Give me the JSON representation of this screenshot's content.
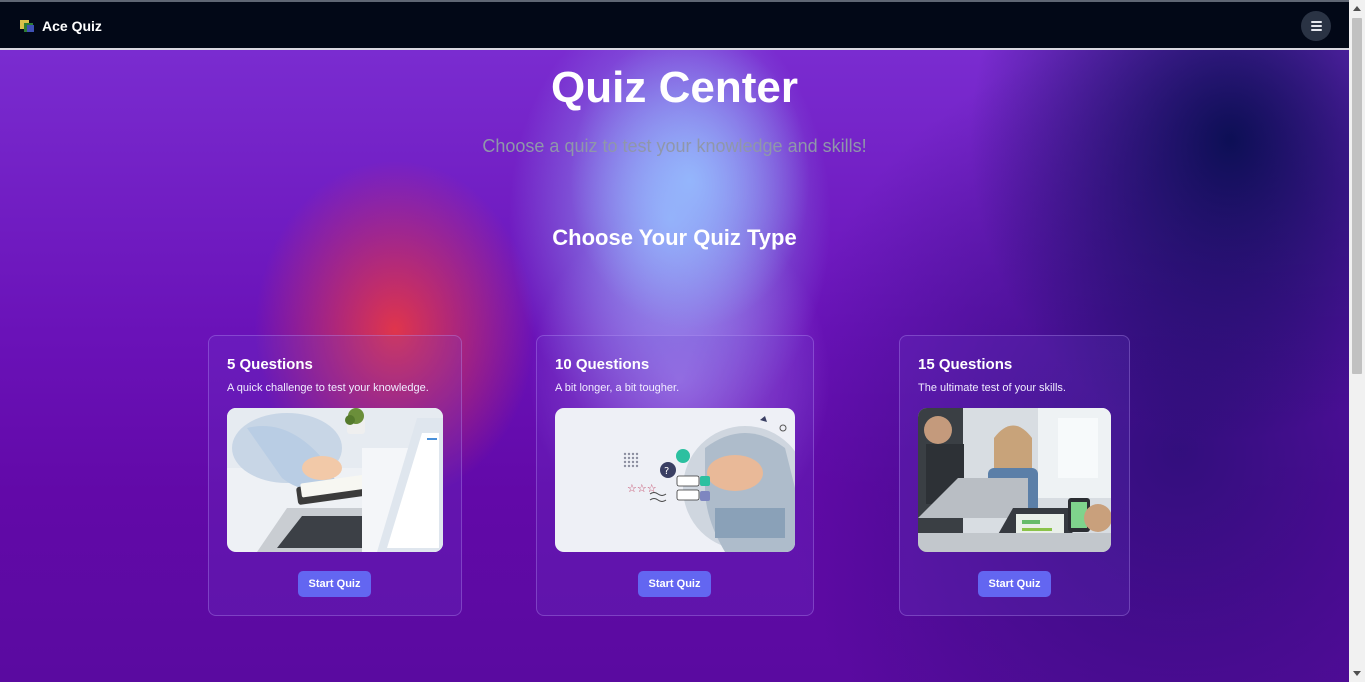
{
  "navbar": {
    "brand": "Ace Quiz",
    "logo_icon": "colored-squares-logo",
    "menu_icon": "hamburger-menu-icon"
  },
  "hero": {
    "title": "Quiz Center",
    "subtitle": "Choose a quiz to test your knowledge and skills!"
  },
  "section": {
    "title": "Choose Your Quiz Type"
  },
  "cards": [
    {
      "title": "5 Questions",
      "description": "A quick challenge to test your knowledge.",
      "image": "person-writing-notes-at-laptop",
      "button": "Start Quiz"
    },
    {
      "title": "10 Questions",
      "description": "A bit longer, a bit tougher.",
      "image": "quiz-illustration-with-hand-writing",
      "button": "Start Quiz"
    },
    {
      "title": "15 Questions",
      "description": "The ultimate test of your skills.",
      "image": "team-working-on-laptops",
      "button": "Start Quiz"
    }
  ],
  "colors": {
    "navbar_bg": "#020817",
    "button_bg": "#6366f1",
    "button_text": "#ffffff",
    "background_purple": "#6a12b8"
  }
}
